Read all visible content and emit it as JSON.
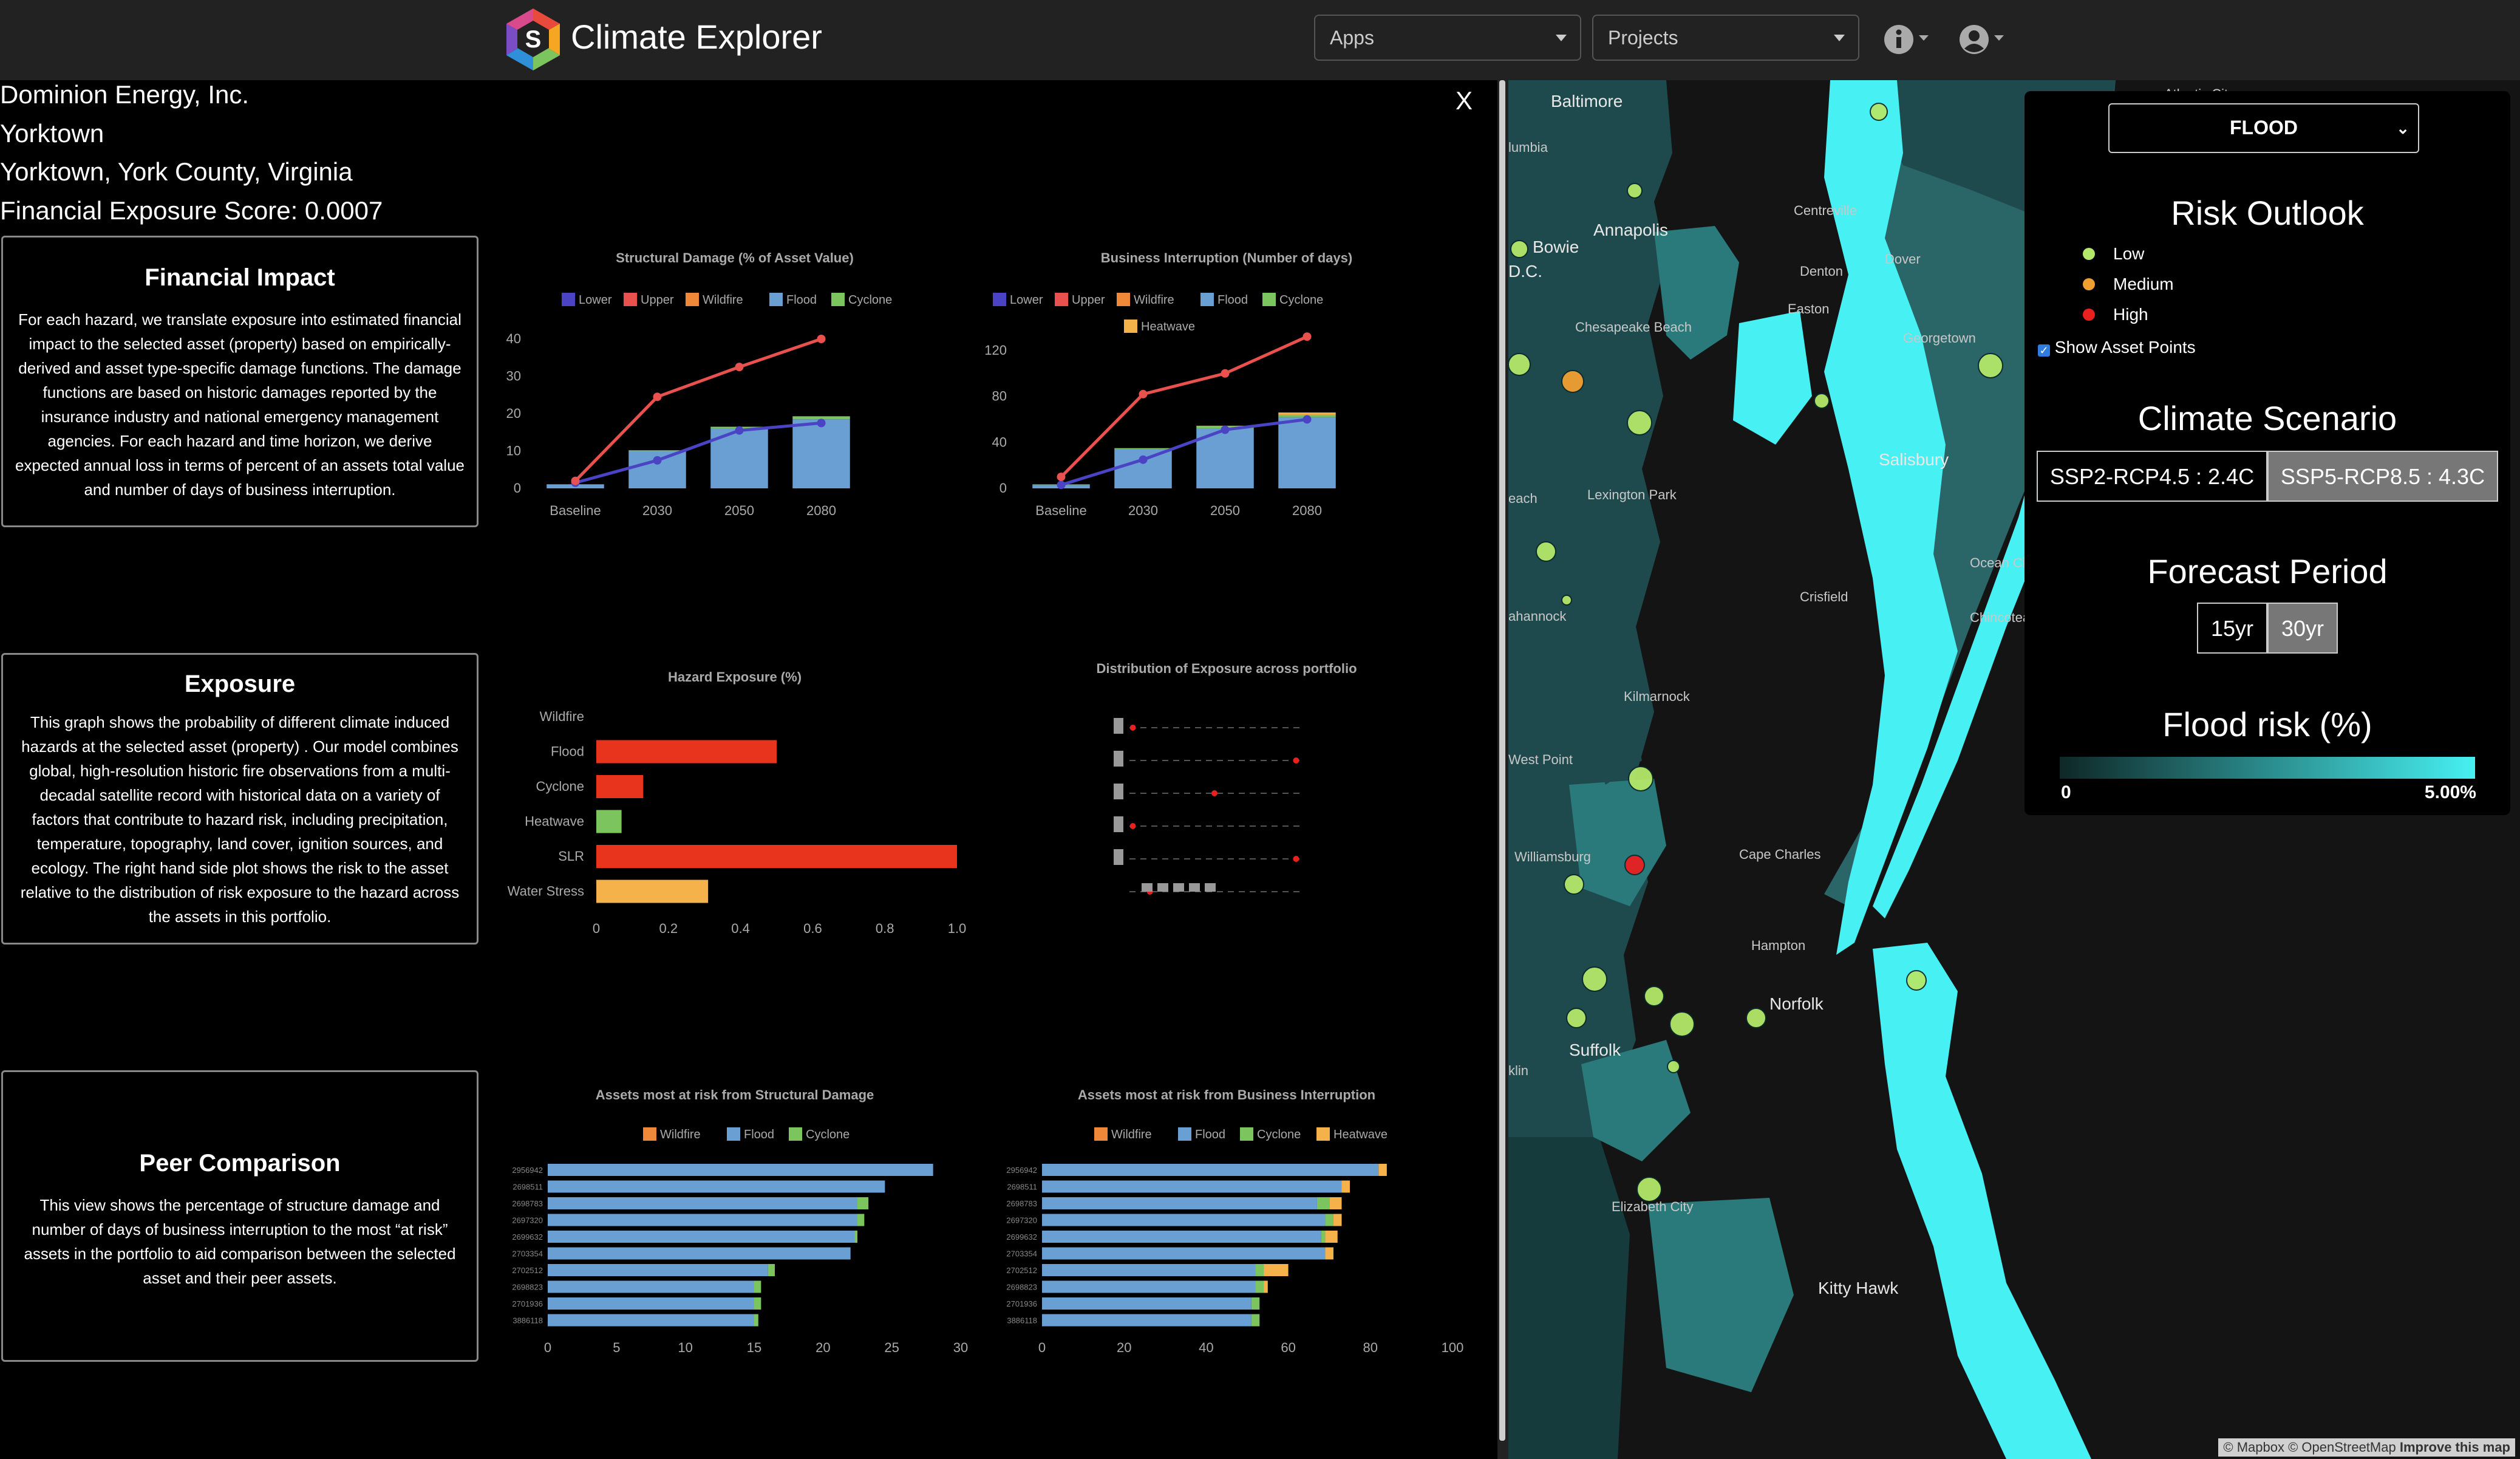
{
  "app": {
    "title": "Climate Explorer",
    "logo_letter": "S",
    "apps_label": "Apps",
    "projects_label": "Projects"
  },
  "asset": {
    "company": "Dominion Energy, Inc.",
    "site": "Yorktown",
    "location": "Yorktown, York County, Virginia",
    "score": "Financial Exposure Score: 0.0007"
  },
  "close_label": "X",
  "sections": {
    "financial": {
      "title": "Financial Impact",
      "body": "For each hazard, we translate exposure into estimated financial impact to the selected asset (property) based on empirically-derived and asset type-specific damage functions. The damage functions are based on historic damages reported by the insurance industry and national emergency management agencies. For each hazard and time horizon, we derive expected annual loss in terms of percent of an assets total value and number of days of business interruption."
    },
    "exposure": {
      "title": "Exposure",
      "body": "This graph shows the probability of different climate induced hazards at the selected asset (property) . Our model combines global, high-resolution historic fire observations from a multi-decadal satellite record with historical data on a variety of factors that contribute to hazard risk, including precipitation, temperature, topography, land cover, ignition sources, and ecology. The right hand side plot shows the risk to the asset relative to the distribution of risk exposure to the hazard across the assets in this portfolio."
    },
    "peer": {
      "title": "Peer Comparison",
      "body": "This view shows the percentage of structure damage and number of days of business interruption to the most “at risk” assets in the portfolio to aid comparison between the selected asset and their peer assets."
    }
  },
  "colors": {
    "lower": "#4a44c4",
    "upper": "#e8514d",
    "wildfire": "#f0883a",
    "flood": "#6a9fd4",
    "cyclone": "#7cc45e",
    "heatwave": "#f5b24a",
    "hazard_red": "#e8341c",
    "map_water": "#47f0f2",
    "map_land": "#1f4a4d"
  },
  "chart_data": [
    {
      "id": "structural",
      "type": "bar",
      "title": "Structural Damage (% of Asset Value)",
      "legend": [
        "Lower",
        "Upper",
        "Wildfire",
        "Flood",
        "Cyclone"
      ],
      "categories": [
        "Baseline",
        "2030",
        "2050",
        "2080"
      ],
      "series": [
        {
          "name": "Wildfire",
          "values": [
            0,
            0,
            0,
            0
          ]
        },
        {
          "name": "Flood",
          "values": [
            1,
            10,
            16,
            18.5
          ]
        },
        {
          "name": "Cyclone",
          "values": [
            0.1,
            0.2,
            0.5,
            0.8
          ]
        }
      ],
      "lines": [
        {
          "name": "Lower",
          "values": [
            1.5,
            7.5,
            15.5,
            17.5
          ]
        },
        {
          "name": "Upper",
          "values": [
            2,
            24.5,
            32.5,
            40
          ]
        }
      ],
      "ylim": [
        0,
        40
      ],
      "yticks": [
        0,
        10,
        20,
        30,
        40
      ]
    },
    {
      "id": "business",
      "type": "bar",
      "title": "Business Interruption (Number of days)",
      "legend": [
        "Lower",
        "Upper",
        "Wildfire",
        "Flood",
        "Cyclone",
        "Heatwave"
      ],
      "categories": [
        "Baseline",
        "2030",
        "2050",
        "2080"
      ],
      "series": [
        {
          "name": "Wildfire",
          "values": [
            0,
            0,
            0,
            0
          ]
        },
        {
          "name": "Flood",
          "values": [
            3,
            34,
            52,
            62
          ]
        },
        {
          "name": "Cyclone",
          "values": [
            0.5,
            1,
            2,
            2
          ]
        },
        {
          "name": "Heatwave",
          "values": [
            0,
            0,
            0.5,
            2
          ]
        }
      ],
      "lines": [
        {
          "name": "Lower",
          "values": [
            3,
            25,
            51,
            60
          ]
        },
        {
          "name": "Upper",
          "values": [
            10,
            82,
            100,
            132
          ]
        }
      ],
      "ylim": [
        0,
        130
      ],
      "yticks": [
        0,
        40,
        80,
        120
      ]
    },
    {
      "id": "hazard",
      "type": "bar",
      "title": "Hazard Exposure (%)",
      "orientation": "horizontal",
      "categories": [
        "Wildfire",
        "Flood",
        "Cyclone",
        "Heatwave",
        "SLR",
        "Water Stress"
      ],
      "values": [
        0,
        0.5,
        0.13,
        0.07,
        1.0,
        0.31
      ],
      "bar_colors": [
        "#e8341c",
        "#e8341c",
        "#e8341c",
        "#7cc45e",
        "#e8341c",
        "#f5b24a"
      ],
      "xlim": [
        0,
        1.0
      ],
      "xticks": [
        "0",
        "0.2",
        "0.4",
        "0.6",
        "0.8",
        "1.0"
      ]
    },
    {
      "id": "distribution",
      "type": "scatter",
      "title": "Distribution of Exposure across portfolio",
      "rows": 6,
      "marker_positions": [
        0.02,
        0.98,
        0.5,
        0.02,
        0.98,
        0.12
      ]
    },
    {
      "id": "peer-structural",
      "type": "bar",
      "orientation": "horizontal",
      "title": "Assets most at risk from Structural Damage",
      "legend": [
        "Wildfire",
        "Flood",
        "Cyclone"
      ],
      "categories": [
        "2956942",
        "2698511",
        "2698783",
        "2697320",
        "2699632",
        "2703354",
        "2702512",
        "2698823",
        "2701936",
        "3886118"
      ],
      "series": [
        {
          "name": "Wildfire",
          "values": [
            0,
            0,
            0,
            0,
            0,
            0,
            0,
            0,
            0,
            0
          ]
        },
        {
          "name": "Flood",
          "values": [
            28,
            24.5,
            22.5,
            22.5,
            22.3,
            22,
            16,
            15,
            15,
            15
          ]
        },
        {
          "name": "Cyclone",
          "values": [
            0,
            0,
            0.8,
            0.5,
            0.2,
            0,
            0.5,
            0.5,
            0.5,
            0.3
          ]
        }
      ],
      "xlim": [
        0,
        30
      ],
      "xticks": [
        0,
        5,
        10,
        15,
        20,
        25,
        30
      ]
    },
    {
      "id": "peer-business",
      "type": "bar",
      "orientation": "horizontal",
      "title": "Assets most at risk from Business Interruption",
      "legend": [
        "Wildfire",
        "Flood",
        "Cyclone",
        "Heatwave"
      ],
      "categories": [
        "2956942",
        "2698511",
        "2698783",
        "2697320",
        "2699632",
        "2703354",
        "2702512",
        "2698823",
        "2701936",
        "3886118"
      ],
      "series": [
        {
          "name": "Wildfire",
          "values": [
            0,
            0,
            0,
            0,
            0,
            0,
            0,
            0,
            0,
            0
          ]
        },
        {
          "name": "Flood",
          "values": [
            82,
            73,
            67,
            69,
            68,
            69,
            52,
            52,
            51,
            51
          ]
        },
        {
          "name": "Cyclone",
          "values": [
            0,
            0,
            3,
            2,
            1,
            0,
            2,
            2,
            2,
            2
          ]
        },
        {
          "name": "Heatwave",
          "values": [
            2,
            2,
            3,
            2,
            3,
            2,
            6,
            1,
            0,
            0
          ]
        }
      ],
      "xlim": [
        0,
        100
      ],
      "xticks": [
        0,
        20,
        40,
        60,
        80,
        100
      ]
    }
  ],
  "map": {
    "place_labels": [
      {
        "text": "Baltimore",
        "big": true
      },
      {
        "text": "Atlantic City"
      },
      {
        "text": "lumbia"
      },
      {
        "text": "Annapolis",
        "big": true
      },
      {
        "text": "Centreville"
      },
      {
        "text": "Bowie",
        "big": true
      },
      {
        "text": "D.C.",
        "big": true
      },
      {
        "text": "Denton"
      },
      {
        "text": "Easton"
      },
      {
        "text": "Dover"
      },
      {
        "text": "Chesapeake Beach"
      },
      {
        "text": "Georgetown"
      },
      {
        "text": "Salisbury",
        "big": true
      },
      {
        "text": "Lexington Park"
      },
      {
        "text": "each"
      },
      {
        "text": "Ocean City"
      },
      {
        "text": "Crisfield"
      },
      {
        "text": "ahannock"
      },
      {
        "text": "Chincoteague"
      },
      {
        "text": "Kilmarnock"
      },
      {
        "text": "West Point"
      },
      {
        "text": "Williamsburg"
      },
      {
        "text": "Cape Charles"
      },
      {
        "text": "Hampton"
      },
      {
        "text": "Norfolk",
        "big": true
      },
      {
        "text": "Suffolk",
        "big": true
      },
      {
        "text": "klin"
      },
      {
        "text": "Elizabeth City"
      },
      {
        "text": "Kitty Hawk",
        "big": true
      }
    ],
    "attribution": "© Mapbox © OpenStreetMap",
    "improve_label": "Improve this map"
  },
  "controls": {
    "hazard_select": "FLOOD",
    "risk_outlook_title": "Risk Outlook",
    "risk_levels": [
      {
        "label": "Low",
        "color": "#b4e86a"
      },
      {
        "label": "Medium",
        "color": "#f0a030"
      },
      {
        "label": "High",
        "color": "#e82020"
      }
    ],
    "show_asset_points": "Show Asset Points",
    "show_asset_points_checked": true,
    "scenario_title": "Climate Scenario",
    "scenario_options": [
      "SSP2-RCP4.5 : 2.4C",
      "SSP5-RCP8.5 : 4.3C"
    ],
    "scenario_selected": "SSP5-RCP8.5 : 4.3C",
    "forecast_title": "Forecast Period",
    "forecast_options": [
      "15yr",
      "30yr"
    ],
    "forecast_selected": "30yr",
    "flood_legend_title": "Flood risk (%)",
    "flood_legend_min": "0",
    "flood_legend_max": "5.00%"
  }
}
